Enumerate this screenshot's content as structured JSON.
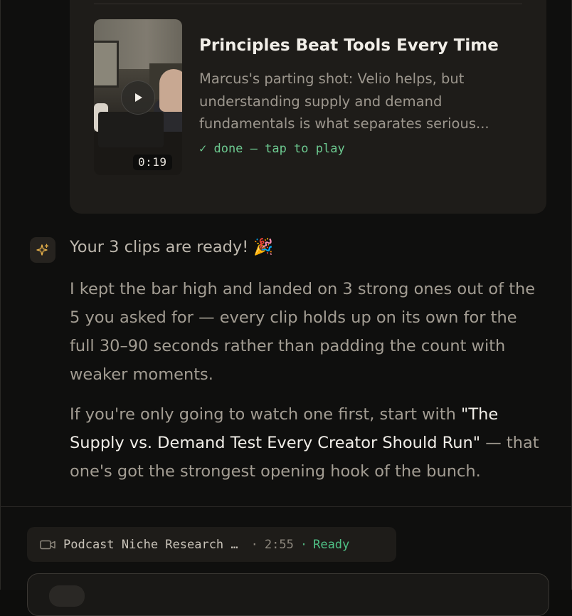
{
  "clip": {
    "title": "Principles Beat Tools Every Time",
    "description": "Marcus's parting shot: Velio helps, but understanding supply and demand fundamentals is what separates serious...",
    "status": "✓ done — tap to play",
    "duration": "0:19"
  },
  "message": {
    "heading": "Your 3 clips are ready! 🎉",
    "paragraph1": "I kept the bar high and landed on 3 strong ones out of the 5 you asked for — every clip holds up on its own for the full 30–90 seconds rather than padding the count with weaker moments.",
    "p2_before": "If you're only going to watch one first, start with ",
    "p2_highlight": "\"The Supply vs. Demand Test Every Creator Should Run\"",
    "p2_after": " — that one's got the strongest opening hook of the bunch."
  },
  "source_chip": {
    "name": "Podcast Niche Research …",
    "separator": "·",
    "duration": "2:55",
    "status_separator": "·",
    "status": "Ready"
  },
  "colors": {
    "accent_green": "#4fc186",
    "sparkle": "#e6b04a",
    "card_bg": "#1e1c19"
  },
  "icons": {
    "assistant": "sparkle-icon",
    "play": "play-icon",
    "video": "video-camera-icon"
  }
}
